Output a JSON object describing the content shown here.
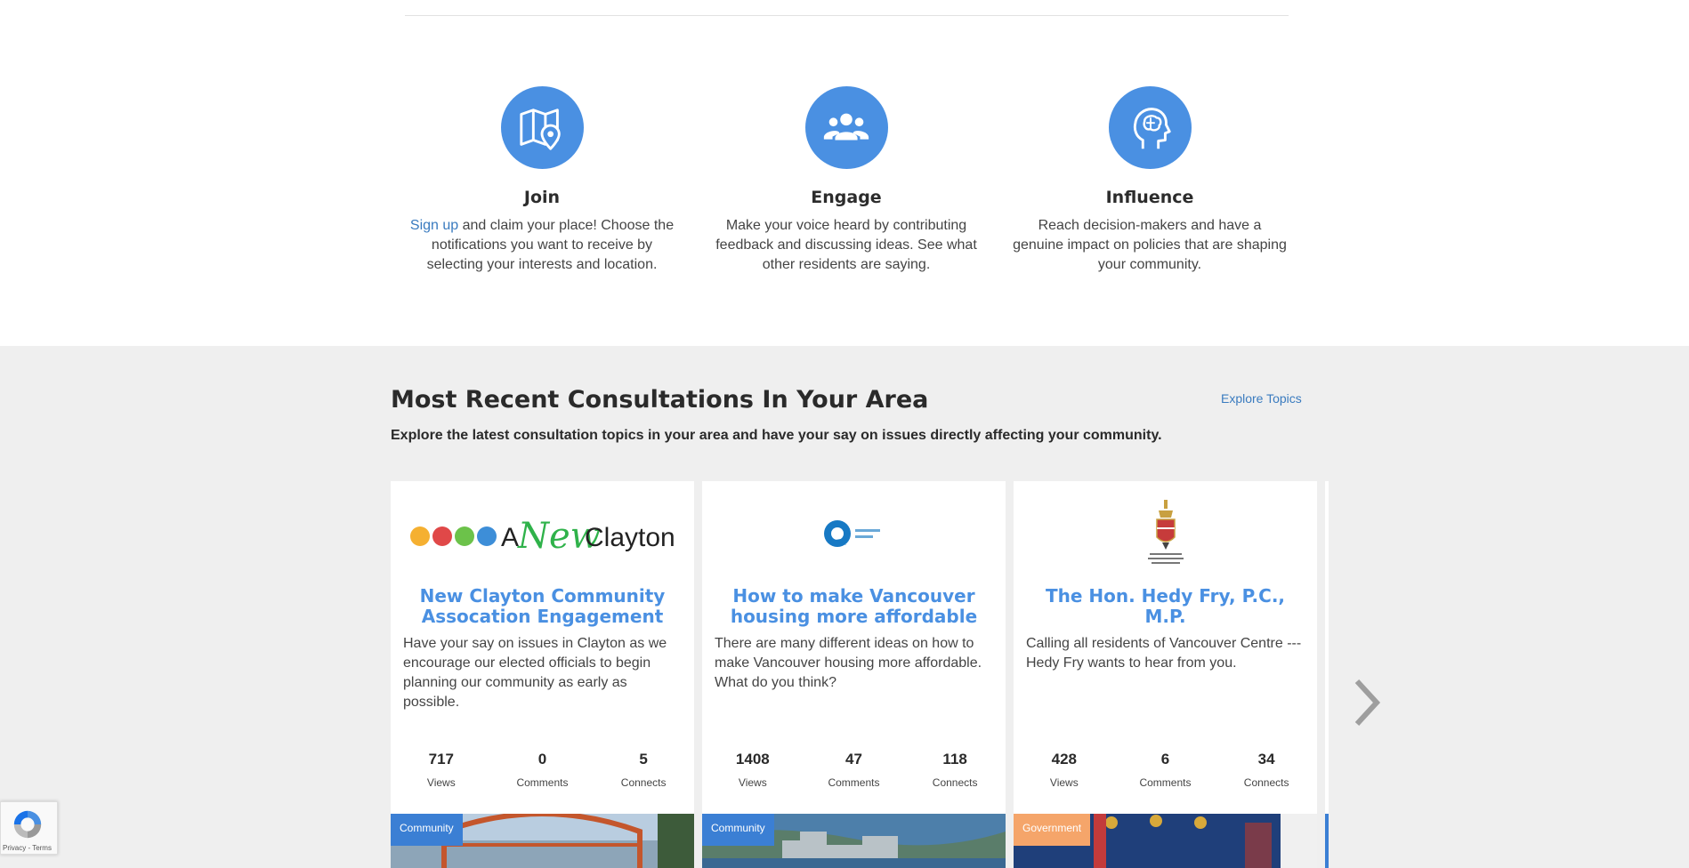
{
  "features": [
    {
      "icon": "map-pin-icon",
      "title": "Join",
      "link_text": "Sign up",
      "text": " and claim your place! Choose the notifications you want to receive by selecting your interests and location."
    },
    {
      "icon": "people-icon",
      "title": "Engage",
      "text": "Make your voice heard by contributing feedback and discussing ideas. See what other residents are saying."
    },
    {
      "icon": "brain-head-icon",
      "title": "Influence",
      "text": "Reach decision-makers and have a genuine impact on policies that are shaping your community."
    }
  ],
  "recent": {
    "title": "Most Recent Consultations In Your Area",
    "explore_link": "Explore Topics",
    "subtitle": "Explore the latest consultation topics in your area and have your say on issues directly affecting your community."
  },
  "cards": [
    {
      "logo_text_a": "A",
      "logo_text_new": "New",
      "logo_text_clayton": "Clayton",
      "title": "New Clayton Community Assocation Engagement",
      "desc": "Have your say on issues in Clayton as we encourage our elected officials to begin planning our community as early as possible.",
      "views": "717",
      "comments": "0",
      "connects": "5",
      "badge": "Community"
    },
    {
      "title": "How to make Vancouver housing more affordable",
      "desc": "There are many different ideas on how to make Vancouver housing more affordable. What do you think?",
      "views": "1408",
      "comments": "47",
      "connects": "118",
      "badge": "Community"
    },
    {
      "title": "The Hon. Hedy Fry, P.C., M.P.",
      "desc": "Calling all residents of Vancouver Centre --- Hedy Fry wants to hear from you.",
      "views": "428",
      "comments": "6",
      "connects": "34",
      "badge": "Government"
    }
  ],
  "labels": {
    "views": "Views",
    "comments": "Comments",
    "connects": "Connects"
  },
  "recaptcha": {
    "links": "Privacy - Terms"
  },
  "colors": {
    "accent": "#4a90e2",
    "community_badge": "#3b7fd4",
    "government_badge": "#f5a56a",
    "section_bg": "#efefef"
  }
}
